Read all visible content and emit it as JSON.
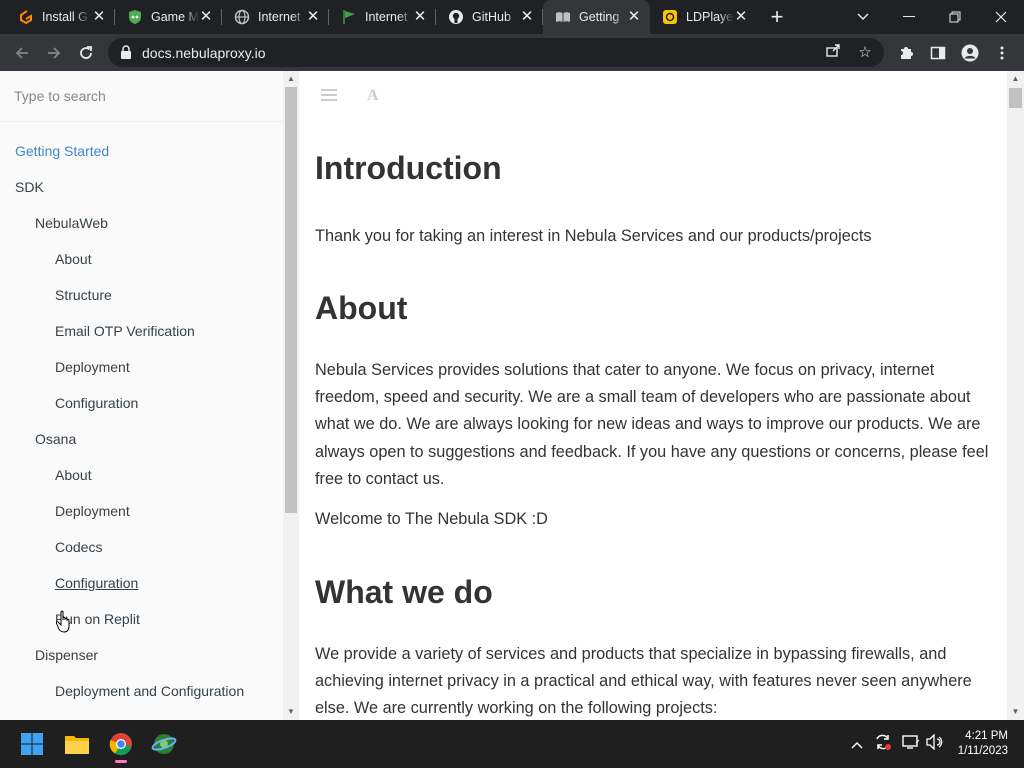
{
  "browser": {
    "tabs": [
      {
        "title": "Install G",
        "icon": "gitpod-icon"
      },
      {
        "title": "Game M",
        "icon": "shield-game-icon"
      },
      {
        "title": "Internet",
        "icon": "globe-icon"
      },
      {
        "title": "Internet",
        "icon": "green-flag-icon"
      },
      {
        "title": "GitHub",
        "icon": "github-icon"
      },
      {
        "title": "Getting",
        "icon": "book-icon",
        "active": true
      },
      {
        "title": "LDPlaye",
        "icon": "ldplayer-icon"
      }
    ],
    "url": "docs.nebulaproxy.io"
  },
  "sidebar": {
    "search_placeholder": "Type to search",
    "items": [
      {
        "label": "Getting Started",
        "level": 0,
        "active": true
      },
      {
        "label": "SDK",
        "level": 0
      },
      {
        "label": "NebulaWeb",
        "level": 1
      },
      {
        "label": "About",
        "level": 2
      },
      {
        "label": "Structure",
        "level": 2
      },
      {
        "label": "Email OTP Verification",
        "level": 2
      },
      {
        "label": "Deployment",
        "level": 2
      },
      {
        "label": "Configuration",
        "level": 2
      },
      {
        "label": "Osana",
        "level": 1
      },
      {
        "label": "About",
        "level": 2
      },
      {
        "label": "Deployment",
        "level": 2
      },
      {
        "label": "Codecs",
        "level": 2
      },
      {
        "label": "Configuration",
        "level": 2,
        "hover": true
      },
      {
        "label": "Run on Replit",
        "level": 2
      },
      {
        "label": "Dispenser",
        "level": 1
      },
      {
        "label": "Deployment and Configuration",
        "level": 2
      }
    ]
  },
  "content": {
    "h_intro": "Introduction",
    "p_intro": "Thank you for taking an interest in Nebula Services and our products/projects",
    "h_about": "About",
    "p_about": "Nebula Services provides solutions that cater to anyone. We focus on privacy, internet freedom, speed and security. We are a small team of developers who are passionate about what we do. We are always looking for new ideas and ways to improve our products. We are always open to suggestions and feedback. If you have any questions or concerns, please feel free to contact us.",
    "p_welcome": "Welcome to The Nebula SDK :D",
    "h_what": "What we do",
    "p_what": "We provide a variety of services and products that specialize in bypassing firewalls, and achieving internet privacy in a practical and ethical way, with features never seen anywhere else. We are currently working on the following projects:"
  },
  "taskbar": {
    "time": "4:21 PM",
    "date": "1/11/2023",
    "apps": [
      "windows-start-icon",
      "file-explorer-icon",
      "chrome-icon",
      "network-app-icon"
    ]
  },
  "colors": {
    "active_link": "#3f88c5",
    "tab_bg": "#202124",
    "toolbar_bg": "#35363a"
  }
}
